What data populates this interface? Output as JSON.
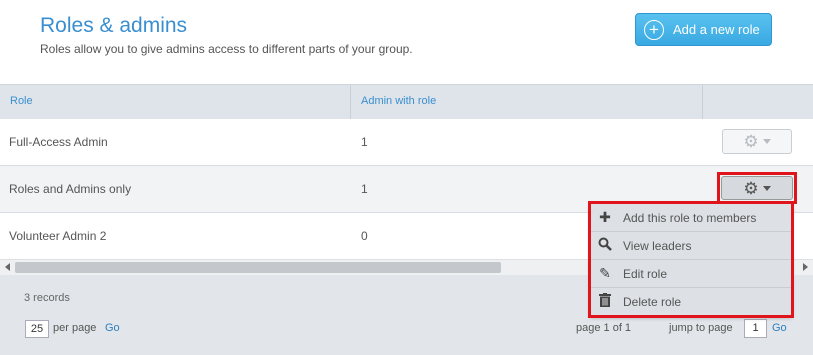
{
  "header": {
    "title": "Roles & admins",
    "subtitle": "Roles allow you to give admins access to different parts of your group.",
    "add_button_label": "Add a new role"
  },
  "table": {
    "columns": [
      "Role",
      "Admin with role",
      ""
    ],
    "rows": [
      {
        "role": "Full-Access Admin",
        "count": "1"
      },
      {
        "role": "Roles and Admins only",
        "count": "1"
      },
      {
        "role": "Volunteer Admin 2",
        "count": "0"
      }
    ]
  },
  "menu": {
    "items": [
      {
        "label": "Add this role to members",
        "icon": "plus-icon"
      },
      {
        "label": "View leaders",
        "icon": "search-icon"
      },
      {
        "label": "Edit role",
        "icon": "pencil-icon"
      },
      {
        "label": "Delete role",
        "icon": "trash-icon"
      }
    ]
  },
  "footer": {
    "records": "3 records",
    "per_page_value": "25",
    "per_page_label": "per page",
    "go_label": "Go",
    "page_info": "page 1 of 1",
    "jump_label": "jump to page",
    "jump_value": "1",
    "jump_go_label": "Go"
  },
  "colors": {
    "accent": "#3a8fd0",
    "button": "#3aa9e2",
    "highlight": "#e0151b"
  }
}
